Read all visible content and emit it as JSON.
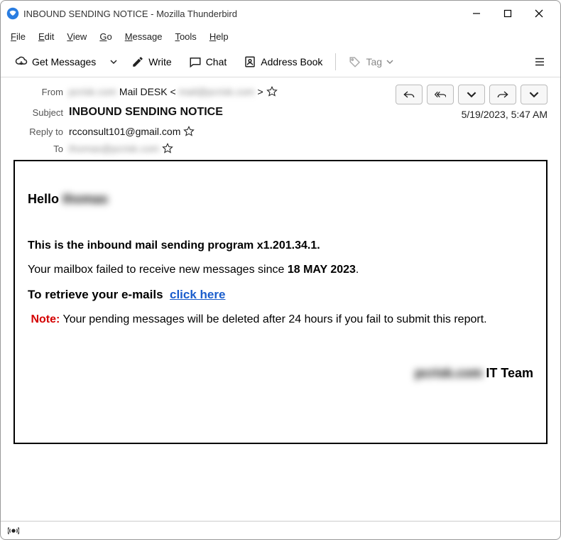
{
  "window": {
    "title": "INBOUND SENDING NOTICE - Mozilla Thunderbird"
  },
  "menu": {
    "file": "File",
    "edit": "Edit",
    "view": "View",
    "go": "Go",
    "message": "Message",
    "tools": "Tools",
    "help": "Help"
  },
  "toolbar": {
    "get_messages": "Get Messages",
    "write": "Write",
    "chat": "Chat",
    "address_book": "Address Book",
    "tag": "Tag"
  },
  "headers": {
    "from_label": "From",
    "from_blur1": "pcrisk.com",
    "from_text": " Mail DESK < ",
    "from_blur2": "mail@pcrisk.com",
    "from_suffix": " > ",
    "subject_label": "Subject",
    "subject": "INBOUND SENDING NOTICE",
    "replyto_label": "Reply to",
    "replyto": "rcconsult101@gmail.com",
    "to_label": "To",
    "to_blur": "thomas@pcrisk.com",
    "date": "5/19/2023, 5:47 AM"
  },
  "body": {
    "hello": "Hello ",
    "hello_blur": "thomas",
    "line1": "This is the inbound mail sending program x1.201.34.1.",
    "line2a": "Your mailbox failed to receive new messages since ",
    "line2b": "18 MAY 2023",
    "line2c": ".",
    "retrieve": "To retrieve your e-mails ",
    "click_here": "click here",
    "note_label": "Note:",
    "note_text": " Your pending messages will be deleted after 24 hours if you fail to submit this report.",
    "sig_blur": "pcrisk.com",
    "sig_text": " IT Team"
  }
}
